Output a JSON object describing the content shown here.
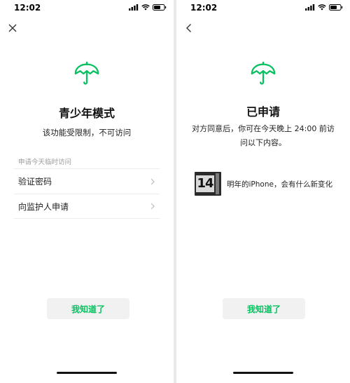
{
  "left": {
    "status_time": "12:02",
    "title": "青少年模式",
    "subtitle": "该功能受限制，不可访问",
    "section_label": "申请今天临时访问",
    "menu_items": [
      {
        "label": "验证密码"
      },
      {
        "label": "向监护人申请"
      }
    ],
    "ack_label": "我知道了"
  },
  "right": {
    "status_time": "12:02",
    "title": "已申请",
    "description": "对方同意后，你可在今天晚上 24:00 前访问以下内容。",
    "article": {
      "thumb_text": "14",
      "title": "明年的iPhone，会有什么新变化"
    },
    "ack_label": "我知道了"
  },
  "colors": {
    "accent": "#07c160",
    "button_bg": "#f1f1f1"
  },
  "icons": [
    "close-icon",
    "back-icon",
    "umbrella-icon",
    "chevron-right-icon",
    "signal-icon",
    "wifi-icon",
    "battery-icon"
  ]
}
